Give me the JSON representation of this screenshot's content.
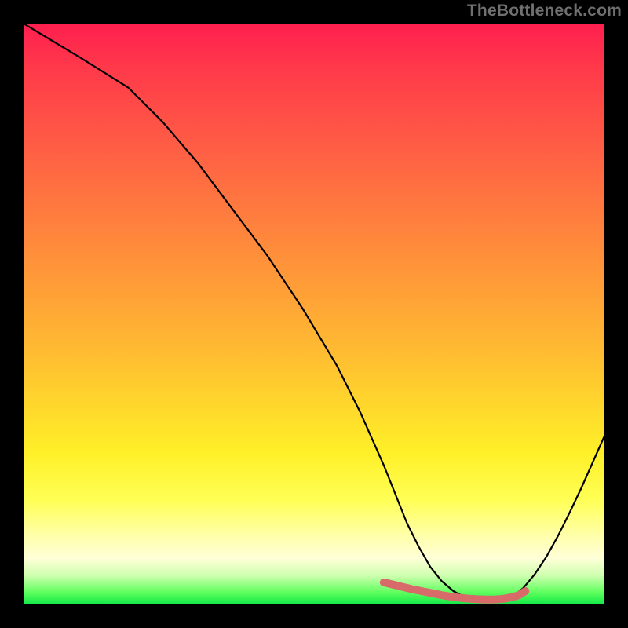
{
  "watermark": "TheBottleneck.com",
  "colors": {
    "background": "#000000",
    "curve": "#000000",
    "marker": "#d86a6a",
    "gradient_top": "#ff1f4f",
    "gradient_bottom": "#12e84a"
  },
  "chart_data": {
    "type": "line",
    "title": "",
    "xlabel": "",
    "ylabel": "",
    "xlim": [
      0,
      100
    ],
    "ylim": [
      0,
      100
    ],
    "x": [
      0,
      5,
      10,
      14,
      18,
      24,
      30,
      36,
      42,
      48,
      54,
      58,
      62,
      64,
      66,
      68,
      70,
      72,
      74,
      76,
      78,
      80,
      82,
      84,
      86,
      88,
      90,
      92,
      94,
      96,
      98,
      100
    ],
    "values": [
      100,
      97,
      94,
      91.5,
      89,
      83,
      76,
      68,
      60,
      51,
      41,
      33,
      24,
      19,
      14,
      10,
      6.5,
      4,
      2.3,
      1.2,
      0.6,
      0.4,
      0.5,
      1.2,
      2.8,
      5.2,
      8.2,
      11.8,
      15.8,
      20,
      24.5,
      29
    ],
    "markers_x": [
      62,
      64.5,
      67,
      69,
      70.5,
      72,
      73.5,
      75,
      76.5,
      78,
      79.5,
      81,
      82.5,
      83.6,
      85.2,
      86.4
    ],
    "markers_y": [
      3.8,
      3.2,
      2.6,
      2.2,
      1.9,
      1.6,
      1.35,
      1.15,
      1.0,
      0.9,
      0.85,
      0.85,
      0.95,
      1.15,
      1.55,
      2.3
    ],
    "annotations": []
  }
}
